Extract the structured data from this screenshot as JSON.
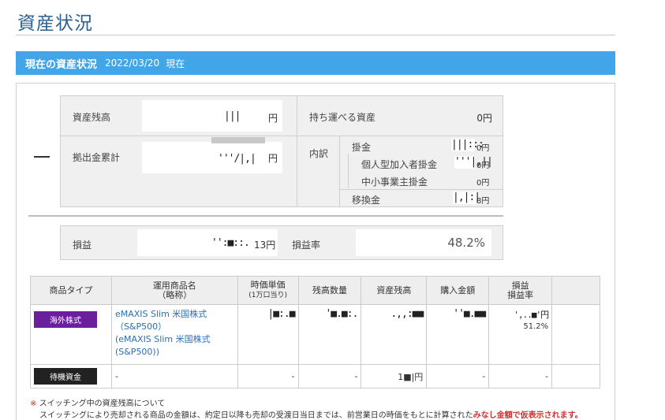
{
  "page_title": "資産状況",
  "banner": {
    "label": "現在の資産状況",
    "date": "2022/03/20",
    "suffix": "現在"
  },
  "summary": {
    "asset_balance_label": "資産残高",
    "asset_balance_masked": "|||",
    "contribution_total_label": "拠出金累計",
    "contribution_total_masked": "'''/|,|",
    "unit_yen": "円",
    "portable_assets_label": "持ち運べる資産",
    "portable_assets_value": "0円",
    "breakdown_label": "内訳",
    "breakdown": [
      {
        "label": "掛金",
        "masked": "|||:::",
        "unit": "0円"
      },
      {
        "label": "個人型加入者掛金",
        "masked": "'''|,||",
        "unit": "0円"
      },
      {
        "label": "中小事業主掛金",
        "masked": "",
        "unit": "0円"
      },
      {
        "label": "移換金",
        "masked": "|,|:|",
        "unit": "8円"
      }
    ]
  },
  "profit": {
    "label": "損益",
    "masked": "'':■::. ",
    "unit": "13円",
    "rate_label": "損益率",
    "rate_value": "48.2%"
  },
  "table": {
    "headers": [
      {
        "line1": "商品タイプ",
        "line2": ""
      },
      {
        "line1": "運用商品名",
        "line2": "（略称）"
      },
      {
        "line1": "時価単価",
        "line2": "(1万口当り)"
      },
      {
        "line1": "残高数量",
        "line2": ""
      },
      {
        "line1": "資産残高",
        "line2": ""
      },
      {
        "line1": "購入金額",
        "line2": ""
      },
      {
        "line1": "損益",
        "line2": "損益率"
      },
      {
        "line1": "",
        "line2": ""
      }
    ],
    "row1": {
      "type": "海外株式",
      "fund_name": "eMAXIS Slim 米国株式（S&P500）",
      "fund_short": "(eMAXIS Slim 米国株式(S&P500))",
      "price": "|■:.■",
      "qty": "'■.■:.",
      "balance": ".,,:■■",
      "purchase": "''■.■■",
      "pl": "',..■'円",
      "pl_rate": "51.2%"
    },
    "row2": {
      "type": "待機資金",
      "fund_name": "-",
      "price": "-",
      "qty": "-",
      "balance": "1■|円",
      "purchase": "-",
      "pl": "-"
    }
  },
  "notes": {
    "note1_mark": "※",
    "note1_text": "スイッチング中の資産残高について",
    "note2_text": "スイッチングにより売却される商品の金額は、約定日以降も売却の受渡日当日までは、前営業日の時価をもとに計算された",
    "note2_red": "みなし金額で仮表示されます。"
  },
  "colors": {
    "banner": "#42a5e8",
    "title": "#2a5f8f",
    "overseas_tag": "#6a1f9e",
    "standby_tag": "#222222",
    "note_red": "#d03030",
    "link": "#2a6fb5"
  }
}
